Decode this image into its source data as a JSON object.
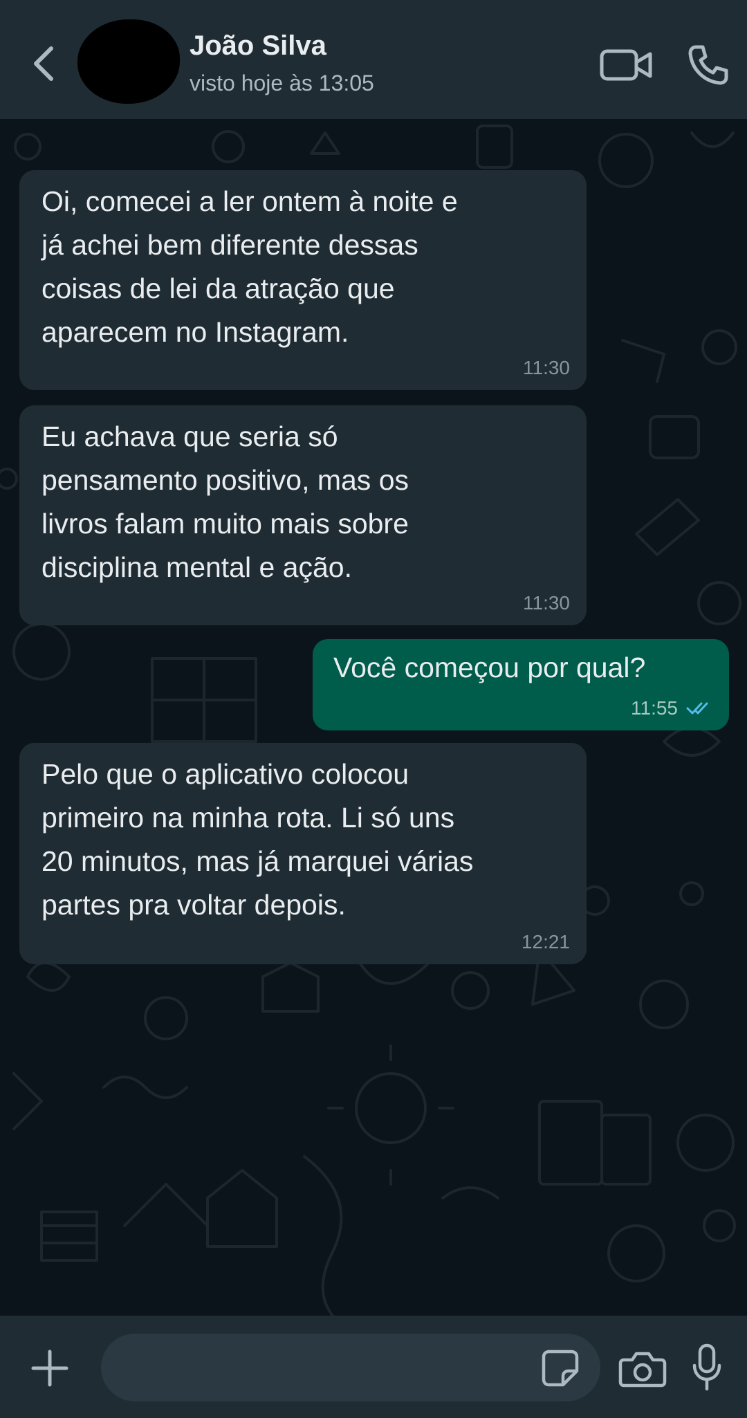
{
  "header": {
    "contact_name": "João Silva",
    "last_seen": "visto hoje às 13:05",
    "icons": [
      "back-arrow-icon",
      "video-call-icon",
      "phone-call-icon"
    ]
  },
  "messages": [
    {
      "direction": "incoming",
      "text": "Oi, comecei a ler ontem à noite e\njá achei bem diferente dessas\ncoisas de lei da atração que\naparecem no Instagram.",
      "time": "11:30"
    },
    {
      "direction": "incoming",
      "text": "Eu achava que seria só\npensamento positivo, mas os\nlivros falam muito mais sobre\ndisciplina mental e ação.",
      "time": "11:30"
    },
    {
      "direction": "outgoing",
      "text": "Você começou por qual?",
      "time": "11:55",
      "status": "read"
    },
    {
      "direction": "incoming",
      "text": "Pelo que o aplicativo colocou\nprimeiro na minha rota. Li só uns\n20 minutos, mas já marquei várias\npartes pra voltar depois.",
      "time": "12:21"
    }
  ],
  "composer": {
    "value": "",
    "placeholder": "",
    "icons": [
      "plus-icon",
      "sticker-icon",
      "camera-icon",
      "microphone-icon"
    ]
  },
  "colors": {
    "header_bg": "#1f2c34",
    "chat_bg": "#0b141a",
    "incoming_bubble": "#202c33",
    "outgoing_bubble": "#005c4b",
    "read_ticks": "#53bdeb"
  }
}
